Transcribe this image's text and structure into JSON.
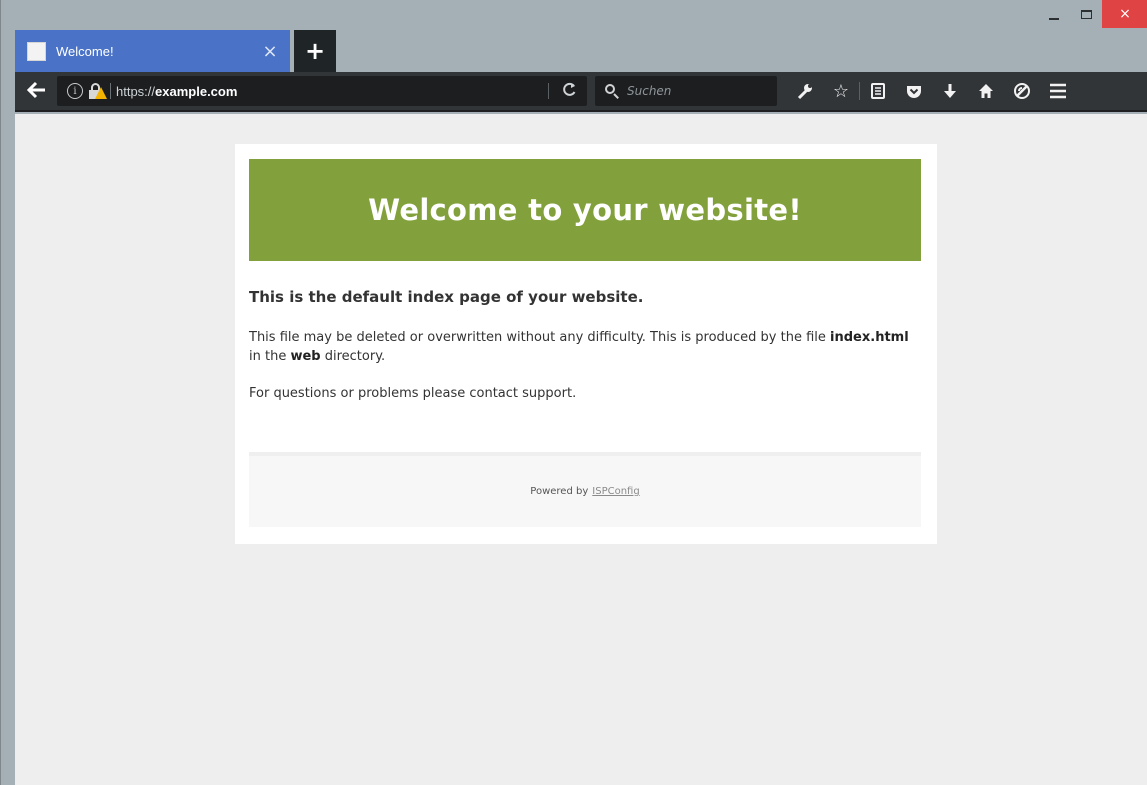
{
  "browser": {
    "tab_title": "Welcome!",
    "new_tab_label": "+",
    "close_tab_glyph": "×",
    "url_prefix": "https://",
    "url_host": "example.com",
    "search_placeholder": "Suchen",
    "reload_glyph": "C",
    "window_close_glyph": "×",
    "toolbar_icons": [
      "wrench-icon",
      "bookmark-star-icon",
      "reading-list-icon",
      "pocket-icon",
      "download-icon",
      "home-icon",
      "no-script-icon",
      "menu-icon"
    ]
  },
  "page": {
    "heading": "Welcome to your website!",
    "subheading": "This is the default index page of your website.",
    "para1_a": "This file may be deleted or overwritten without any difficulty. This is produced by the file ",
    "para1_file": "index.html",
    "para1_b": " in the ",
    "para1_dir": "web",
    "para1_c": " directory.",
    "para2": "For questions or problems please contact support.",
    "footer_text": "Powered by",
    "footer_link": "ISPConfig"
  },
  "colors": {
    "banner": "#82a13c",
    "tab_active": "#4a73c7",
    "close_button": "#e04343"
  }
}
